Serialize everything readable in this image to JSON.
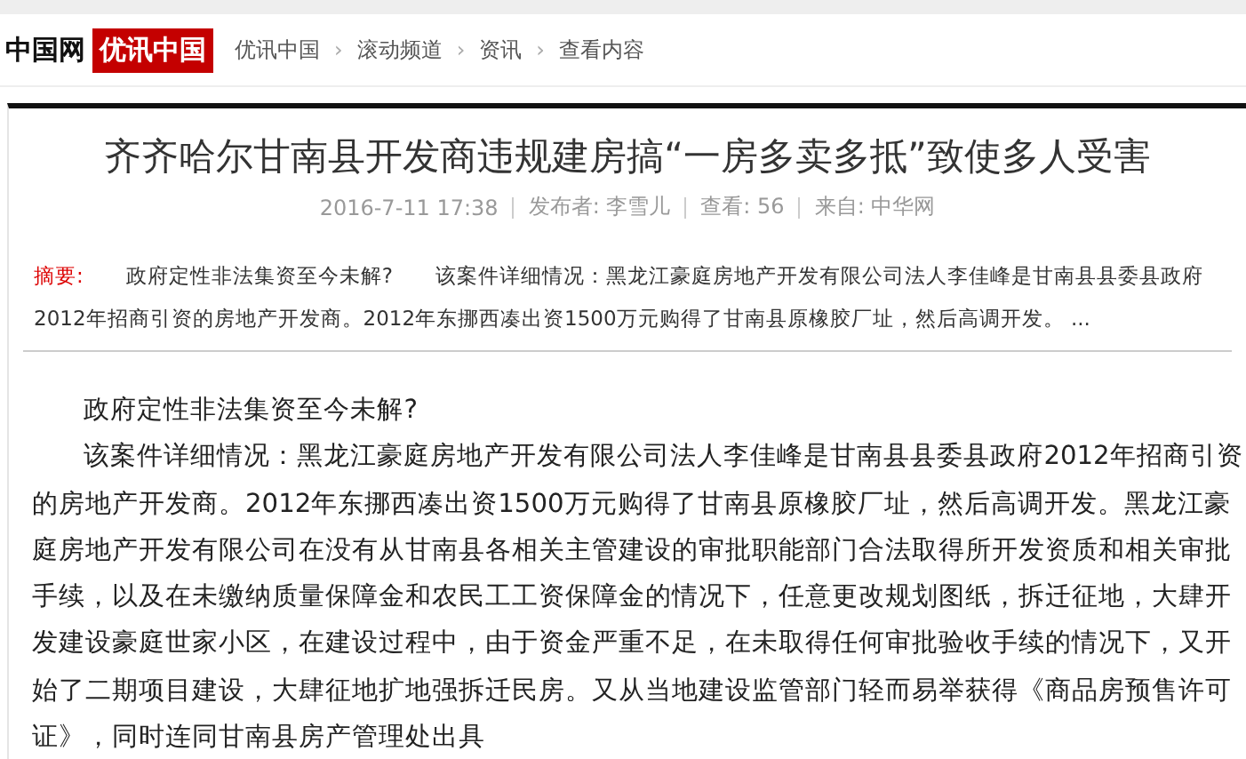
{
  "header": {
    "logo_text": "中国网",
    "logo_badge": "优讯中国",
    "breadcrumb": [
      "优讯中国",
      "滚动频道",
      "资讯",
      "查看内容"
    ],
    "separator": "›"
  },
  "article": {
    "title": "齐齐哈尔甘南县开发商违规建房搞“一房多卖多抵”致使多人受害",
    "meta": [
      "2016-7-11 17:38",
      "发布者: 李雪儿",
      "查看: 56",
      "来自: 中华网"
    ],
    "summary": {
      "label": "摘要:",
      "text": "政府定性非法集资至今未解?　　该案件详细情况：黑龙江豪庭房地产开发有限公司法人李佳峰是甘南县县委县政府2012年招商引资的房地产开发商。2012年东挪西凑出资1500万元购得了甘南县原橡胶厂址，然后高调开发。 ..."
    },
    "paragraphs": [
      "政府定性非法集资至今未解?",
      "该案件详细情况：黑龙江豪庭房地产开发有限公司法人李佳峰是甘南县县委县政府2012年招商引资的房地产开发商。2012年东挪西凑出资1500万元购得了甘南县原橡胶厂址，然后高调开发。黑龙江豪庭房地产开发有限公司在没有从甘南县各相关主管建设的审批职能部门合法取得所开发资质和相关审批手续，以及在未缴纳质量保障金和农民工工资保障金的情况下，任意更改规划图纸，拆迁征地，大肆开发建设豪庭世家小区，在建设过程中，由于资金严重不足，在未取得任何审批验收手续的情况下，又开始了二期项目建设，大肆征地扩地强拆迁民房。又从当地建设监管部门轻而易举获得《商品房预售许可证》，同时连同甘南县房产管理处出具"
    ]
  }
}
